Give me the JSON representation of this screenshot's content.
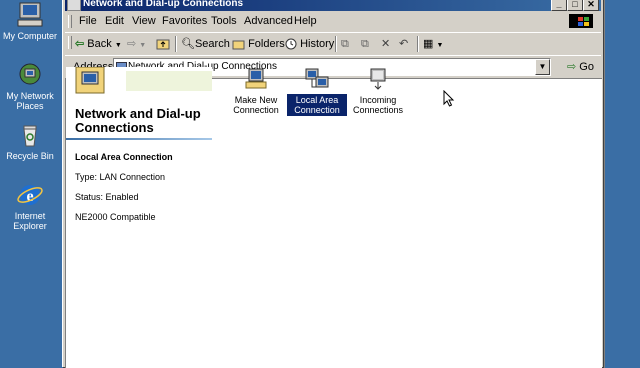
{
  "desktop": {
    "icons": [
      {
        "name": "my-computer-icon",
        "label": "My Computer"
      },
      {
        "name": "my-network-places-icon",
        "label": "My Network Places"
      },
      {
        "name": "recycle-bin-icon",
        "label": "Recycle Bin"
      },
      {
        "name": "internet-explorer-icon",
        "label": "Internet Explorer"
      }
    ]
  },
  "window": {
    "title": "Network and Dial-up Connections",
    "menu": [
      "File",
      "Edit",
      "View",
      "Favorites",
      "Tools",
      "Advanced",
      "Help"
    ],
    "toolbar": {
      "back": "Back",
      "search": "Search",
      "folders": "Folders",
      "history": "History"
    },
    "address": {
      "label": "Address",
      "value": "Network and Dial-up Connections",
      "go": "Go"
    }
  },
  "panel": {
    "title": "Network and Dial-up Connections",
    "selected_name": "Local Area Connection",
    "type": "Type: LAN Connection",
    "status": "Status: Enabled",
    "device": "NE2000 Compatible"
  },
  "items": [
    {
      "label": "Make New Connection",
      "icon": "make-new-connection-icon",
      "selected": false
    },
    {
      "label": "Local Area Connection",
      "icon": "local-area-connection-icon",
      "selected": true
    },
    {
      "label": "Incoming Connections",
      "icon": "incoming-connections-icon",
      "selected": false
    }
  ],
  "colors": {
    "desktop": "#3a6ea5",
    "title_bar": "#0a246a",
    "selection": "#0a246a",
    "window_face": "#d4d0c8"
  }
}
